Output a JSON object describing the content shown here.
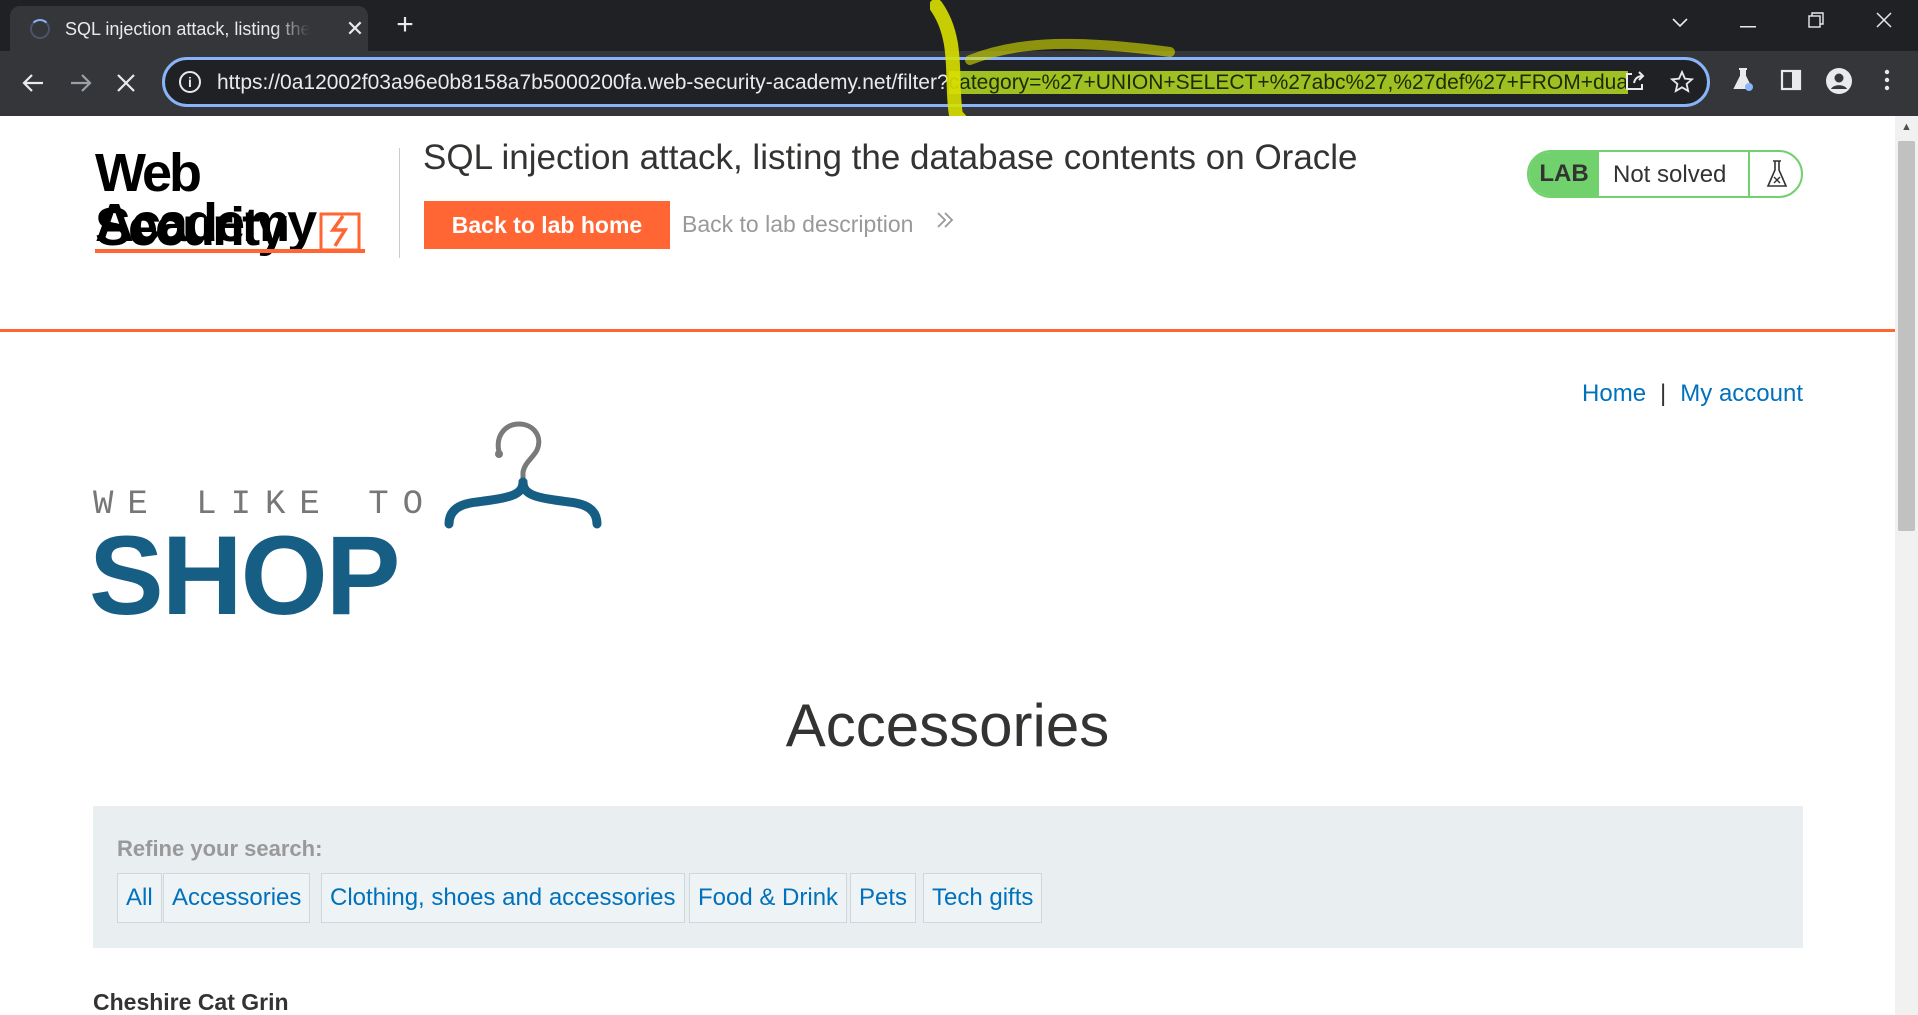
{
  "browser": {
    "tab_title": "SQL injection attack, listing the database contents on Oracle",
    "new_tab_icon": "plus-icon",
    "window_controls": [
      "chevron-down-icon",
      "minimize-icon",
      "restore-icon",
      "close-icon"
    ],
    "url_base": "https://0a12002f03a96e0b8158a7b5000200fa.web-security-academy.net/filter?",
    "url_query_highlighted": "category=%27+UNION+SELECT+%27abc%27,%27def%27+FROM+dua",
    "highlight_color": "#9fc022",
    "accent_color": "#8ab4f8"
  },
  "lab": {
    "logo_line1": "Web Security",
    "logo_line2": "Academy",
    "title": "SQL injection attack, listing the database contents on Oracle",
    "back_home_label": "Back to lab home",
    "back_description_label": "Back to lab description",
    "chevron": "»",
    "badge_label": "LAB",
    "status_text": "Not solved",
    "status_color": "#70d16d",
    "brand_color": "#ff6633"
  },
  "shop": {
    "nav": {
      "home_label": "Home",
      "separator": "|",
      "account_label": "My account"
    },
    "logo_tagline": "WE LIKE TO",
    "logo_word": "SHOP",
    "brand_color": "#175e85",
    "link_color": "#0071bc",
    "category_heading": "Accessories",
    "filter": {
      "label": "Refine your search:",
      "options": [
        "All",
        "Accessories",
        "Clothing, shoes and accessories",
        "Food & Drink",
        "Pets",
        "Tech gifts"
      ]
    },
    "first_product": "Cheshire Cat Grin"
  }
}
